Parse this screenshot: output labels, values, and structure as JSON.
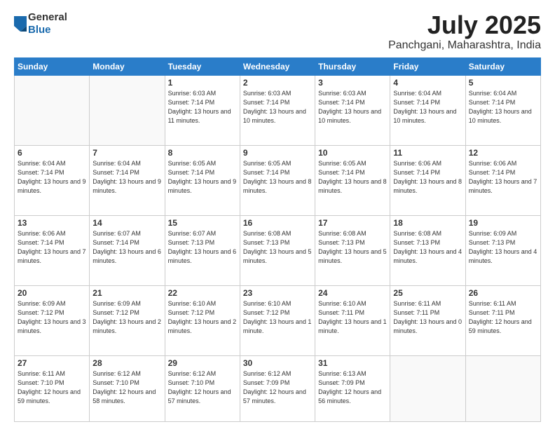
{
  "header": {
    "logo_line1": "General",
    "logo_line2": "Blue",
    "title": "July 2025",
    "location": "Panchgani, Maharashtra, India"
  },
  "weekdays": [
    "Sunday",
    "Monday",
    "Tuesday",
    "Wednesday",
    "Thursday",
    "Friday",
    "Saturday"
  ],
  "weeks": [
    [
      {
        "day": "",
        "info": ""
      },
      {
        "day": "",
        "info": ""
      },
      {
        "day": "1",
        "info": "Sunrise: 6:03 AM\nSunset: 7:14 PM\nDaylight: 13 hours and 11 minutes."
      },
      {
        "day": "2",
        "info": "Sunrise: 6:03 AM\nSunset: 7:14 PM\nDaylight: 13 hours and 10 minutes."
      },
      {
        "day": "3",
        "info": "Sunrise: 6:03 AM\nSunset: 7:14 PM\nDaylight: 13 hours and 10 minutes."
      },
      {
        "day": "4",
        "info": "Sunrise: 6:04 AM\nSunset: 7:14 PM\nDaylight: 13 hours and 10 minutes."
      },
      {
        "day": "5",
        "info": "Sunrise: 6:04 AM\nSunset: 7:14 PM\nDaylight: 13 hours and 10 minutes."
      }
    ],
    [
      {
        "day": "6",
        "info": "Sunrise: 6:04 AM\nSunset: 7:14 PM\nDaylight: 13 hours and 9 minutes."
      },
      {
        "day": "7",
        "info": "Sunrise: 6:04 AM\nSunset: 7:14 PM\nDaylight: 13 hours and 9 minutes."
      },
      {
        "day": "8",
        "info": "Sunrise: 6:05 AM\nSunset: 7:14 PM\nDaylight: 13 hours and 9 minutes."
      },
      {
        "day": "9",
        "info": "Sunrise: 6:05 AM\nSunset: 7:14 PM\nDaylight: 13 hours and 8 minutes."
      },
      {
        "day": "10",
        "info": "Sunrise: 6:05 AM\nSunset: 7:14 PM\nDaylight: 13 hours and 8 minutes."
      },
      {
        "day": "11",
        "info": "Sunrise: 6:06 AM\nSunset: 7:14 PM\nDaylight: 13 hours and 8 minutes."
      },
      {
        "day": "12",
        "info": "Sunrise: 6:06 AM\nSunset: 7:14 PM\nDaylight: 13 hours and 7 minutes."
      }
    ],
    [
      {
        "day": "13",
        "info": "Sunrise: 6:06 AM\nSunset: 7:14 PM\nDaylight: 13 hours and 7 minutes."
      },
      {
        "day": "14",
        "info": "Sunrise: 6:07 AM\nSunset: 7:14 PM\nDaylight: 13 hours and 6 minutes."
      },
      {
        "day": "15",
        "info": "Sunrise: 6:07 AM\nSunset: 7:13 PM\nDaylight: 13 hours and 6 minutes."
      },
      {
        "day": "16",
        "info": "Sunrise: 6:08 AM\nSunset: 7:13 PM\nDaylight: 13 hours and 5 minutes."
      },
      {
        "day": "17",
        "info": "Sunrise: 6:08 AM\nSunset: 7:13 PM\nDaylight: 13 hours and 5 minutes."
      },
      {
        "day": "18",
        "info": "Sunrise: 6:08 AM\nSunset: 7:13 PM\nDaylight: 13 hours and 4 minutes."
      },
      {
        "day": "19",
        "info": "Sunrise: 6:09 AM\nSunset: 7:13 PM\nDaylight: 13 hours and 4 minutes."
      }
    ],
    [
      {
        "day": "20",
        "info": "Sunrise: 6:09 AM\nSunset: 7:12 PM\nDaylight: 13 hours and 3 minutes."
      },
      {
        "day": "21",
        "info": "Sunrise: 6:09 AM\nSunset: 7:12 PM\nDaylight: 13 hours and 2 minutes."
      },
      {
        "day": "22",
        "info": "Sunrise: 6:10 AM\nSunset: 7:12 PM\nDaylight: 13 hours and 2 minutes."
      },
      {
        "day": "23",
        "info": "Sunrise: 6:10 AM\nSunset: 7:12 PM\nDaylight: 13 hours and 1 minute."
      },
      {
        "day": "24",
        "info": "Sunrise: 6:10 AM\nSunset: 7:11 PM\nDaylight: 13 hours and 1 minute."
      },
      {
        "day": "25",
        "info": "Sunrise: 6:11 AM\nSunset: 7:11 PM\nDaylight: 13 hours and 0 minutes."
      },
      {
        "day": "26",
        "info": "Sunrise: 6:11 AM\nSunset: 7:11 PM\nDaylight: 12 hours and 59 minutes."
      }
    ],
    [
      {
        "day": "27",
        "info": "Sunrise: 6:11 AM\nSunset: 7:10 PM\nDaylight: 12 hours and 59 minutes."
      },
      {
        "day": "28",
        "info": "Sunrise: 6:12 AM\nSunset: 7:10 PM\nDaylight: 12 hours and 58 minutes."
      },
      {
        "day": "29",
        "info": "Sunrise: 6:12 AM\nSunset: 7:10 PM\nDaylight: 12 hours and 57 minutes."
      },
      {
        "day": "30",
        "info": "Sunrise: 6:12 AM\nSunset: 7:09 PM\nDaylight: 12 hours and 57 minutes."
      },
      {
        "day": "31",
        "info": "Sunrise: 6:13 AM\nSunset: 7:09 PM\nDaylight: 12 hours and 56 minutes."
      },
      {
        "day": "",
        "info": ""
      },
      {
        "day": "",
        "info": ""
      }
    ]
  ]
}
